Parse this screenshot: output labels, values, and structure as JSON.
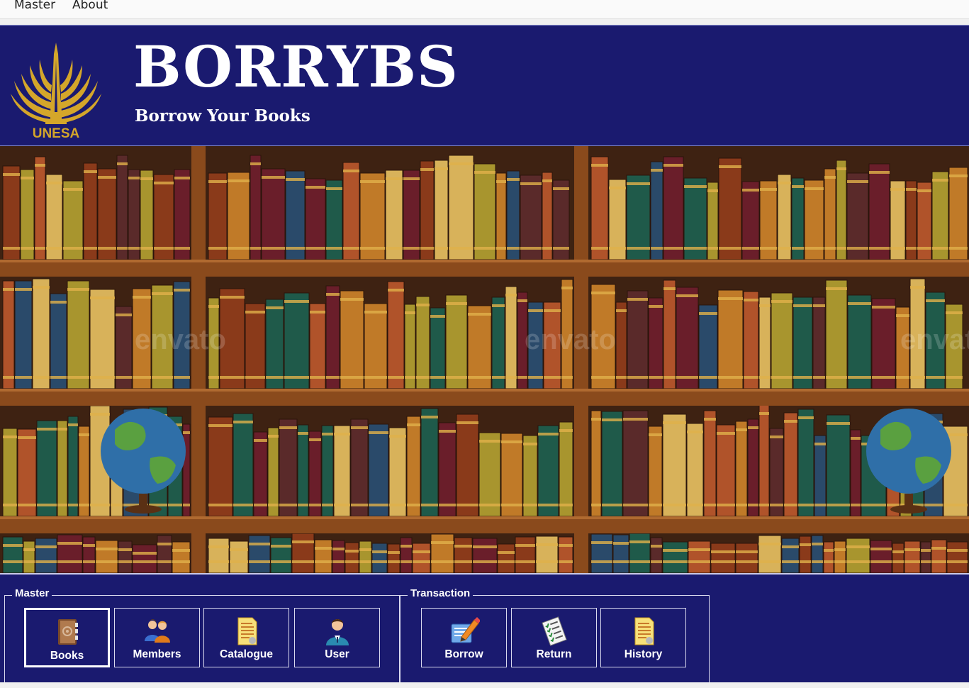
{
  "menubar": {
    "items": [
      {
        "label": "Master"
      },
      {
        "label": "About"
      }
    ]
  },
  "header": {
    "title": "BORRYBS",
    "subtitle": "Borrow Your Books",
    "logo_text": "UNESA"
  },
  "banner": {
    "watermark_text": "envato"
  },
  "master_group": {
    "title": "Master",
    "buttons": [
      {
        "label": "Books",
        "icon": "address-book-icon"
      },
      {
        "label": "Members",
        "icon": "members-icon"
      },
      {
        "label": "Catalogue",
        "icon": "document-icon"
      },
      {
        "label": "User",
        "icon": "user-icon"
      }
    ]
  },
  "transaction_group": {
    "title": "Transaction",
    "buttons": [
      {
        "label": "Borrow",
        "icon": "edit-pencil-icon"
      },
      {
        "label": "Return",
        "icon": "checklist-icon"
      },
      {
        "label": "History",
        "icon": "document-icon"
      }
    ]
  },
  "colors": {
    "navy": "#1a1a6f",
    "shelf_wood": "#8a4a1c",
    "logo_gold": "#d4a62a"
  }
}
